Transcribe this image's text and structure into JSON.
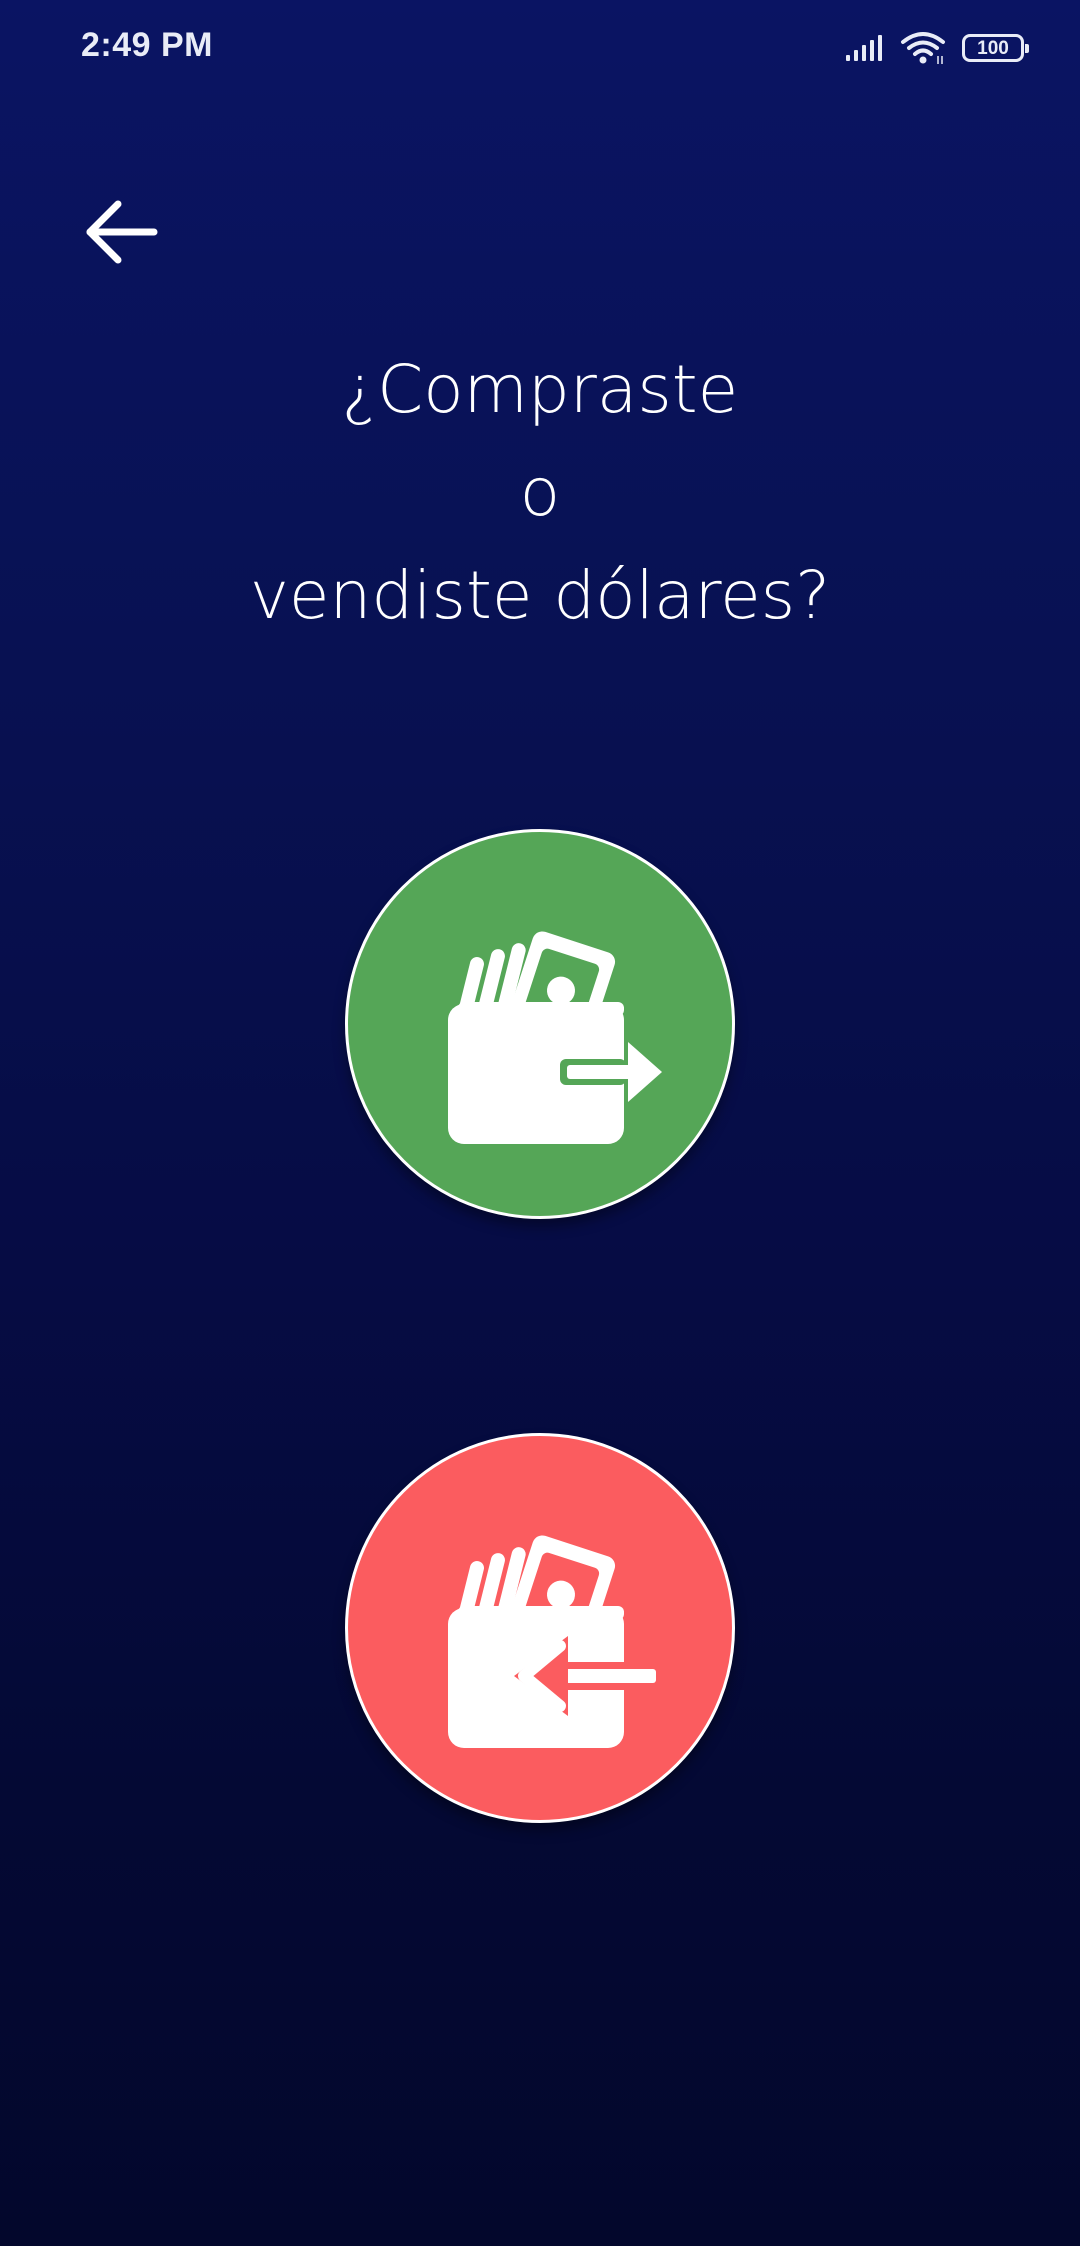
{
  "status_bar": {
    "time": "2:49 PM",
    "battery_level": "100",
    "icons": [
      "signal-icon",
      "wifi-icon",
      "battery-icon"
    ]
  },
  "nav": {
    "back_icon": "arrow-left-icon"
  },
  "question": {
    "line1": "¿Compraste",
    "line2": "o",
    "line3": "vendiste dólares?"
  },
  "actions": [
    {
      "id": "compraste",
      "icon": "wallet-out-arrow-icon",
      "color": "#55a657"
    },
    {
      "id": "vendiste",
      "icon": "wallet-in-arrow-icon",
      "color": "#fb5c5f"
    }
  ],
  "colors": {
    "background_top": "#0a1463",
    "background_bottom": "#03072c",
    "buy_green": "#55a657",
    "sell_red": "#fb5c5f",
    "text": "#ffffff"
  }
}
